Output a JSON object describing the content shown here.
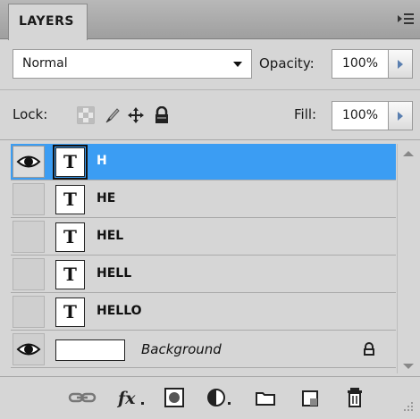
{
  "panel": {
    "tab_label": "LAYERS",
    "menu_icon": "panel-menu-icon"
  },
  "controls": {
    "blend_mode": "Normal",
    "opacity_label": "Opacity:",
    "opacity_value": "100%",
    "lock_label": "Lock:",
    "fill_label": "Fill:",
    "fill_value": "100%"
  },
  "layers": [
    {
      "name": "H",
      "type": "text",
      "visible": true,
      "selected": true
    },
    {
      "name": "HE",
      "type": "text",
      "visible": false,
      "selected": false
    },
    {
      "name": "HEL",
      "type": "text",
      "visible": false,
      "selected": false
    },
    {
      "name": "HELL",
      "type": "text",
      "visible": false,
      "selected": false
    },
    {
      "name": "HELLO",
      "type": "text",
      "visible": false,
      "selected": false
    },
    {
      "name": "Background",
      "type": "background",
      "visible": true,
      "locked": true
    }
  ],
  "thumb_glyph": "T",
  "colors": {
    "selection": "#3b9df3",
    "panel_bg": "#d6d6d6"
  },
  "footer_icons": [
    "link-layers-icon",
    "fx-icon",
    "add-mask-icon",
    "adjustment-layer-icon",
    "new-group-icon",
    "new-layer-icon",
    "trash-icon"
  ]
}
